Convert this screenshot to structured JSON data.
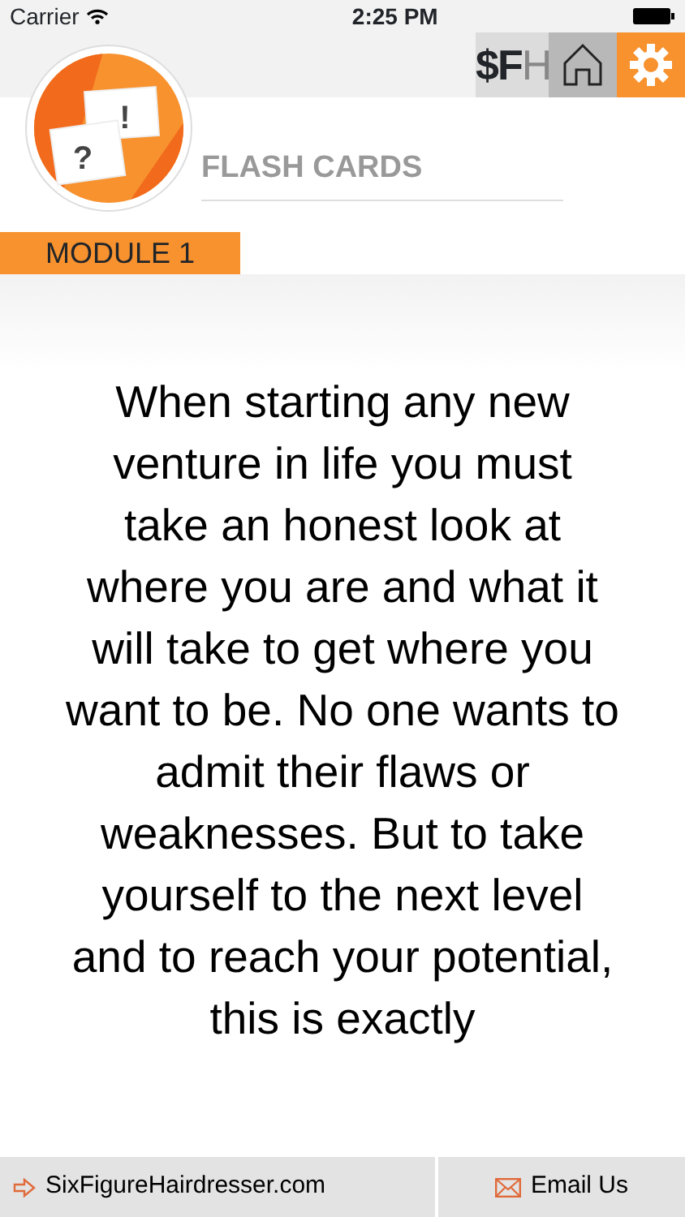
{
  "status_bar": {
    "carrier": "Carrier",
    "time": "2:25 PM"
  },
  "toolbar": {
    "brand": [
      "$F",
      "H"
    ],
    "buttons": [
      {
        "kind": "home",
        "selected": false
      },
      {
        "kind": "settings",
        "selected": true
      }
    ]
  },
  "app_logo": {
    "marks": [
      "?",
      "!"
    ]
  },
  "section_title": "FLASH CARDS",
  "module_label": "MODULE 1",
  "card_text": "When starting any new venture in life you must take an honest look at where you are and what it will take to get where you want to be. No one wants to admit their flaws or weaknesses. But to take yourself to the next level and to reach your potential, this is exactly",
  "footer": {
    "link": "SixFigureHairdresser.com",
    "email": "Email Us"
  }
}
